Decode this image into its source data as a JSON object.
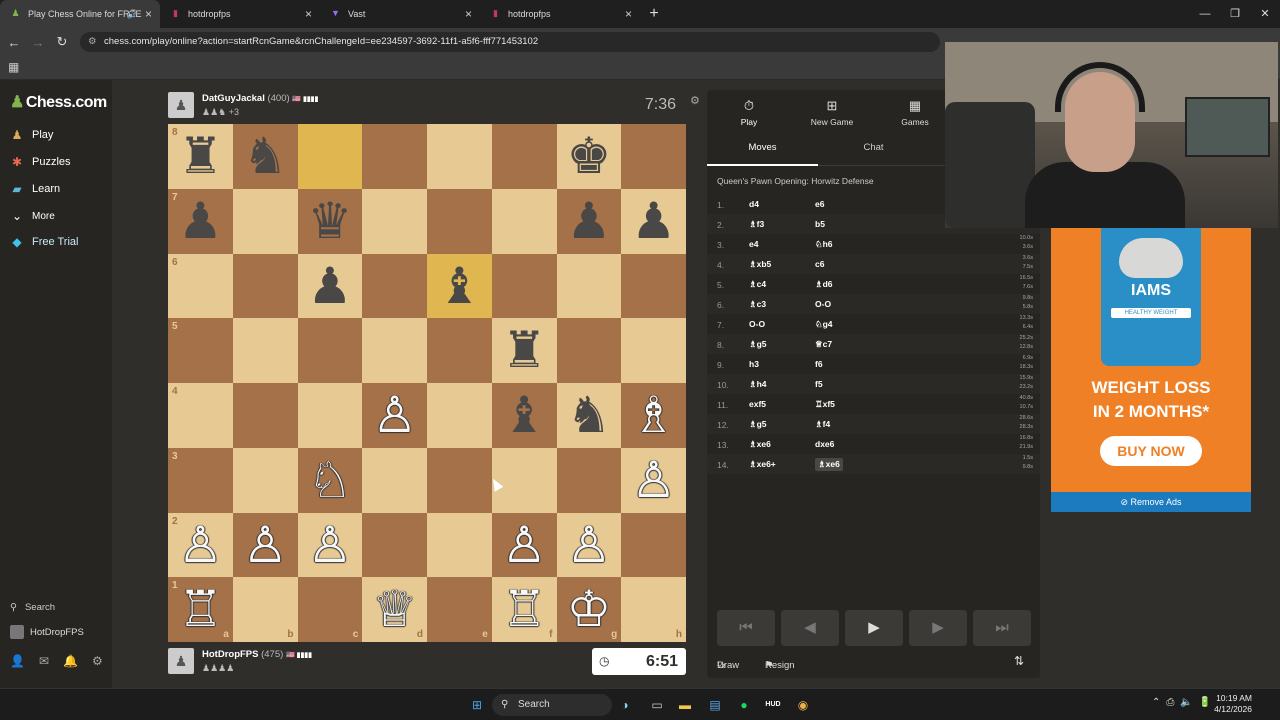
{
  "browser": {
    "tabs": [
      {
        "title": "Play Chess Online for FREE",
        "active": true
      },
      {
        "title": "hotdropfps",
        "active": false
      },
      {
        "title": "Vast",
        "active": false
      },
      {
        "title": "hotdropfps",
        "active": false
      }
    ],
    "url": "chess.com/play/online?action=startRcnGame&rcnChallengeId=ee234597-3692-11f1-a5f6-fff771453102"
  },
  "sidebar": {
    "logo": "Chess.com",
    "items": [
      {
        "label": "Play",
        "icon": "pawn-icon"
      },
      {
        "label": "Puzzles",
        "icon": "puzzle-icon"
      },
      {
        "label": "Learn",
        "icon": "learn-icon"
      },
      {
        "label": "More",
        "icon": "chevron-down-icon"
      },
      {
        "label": "Free Trial",
        "icon": "diamond-icon"
      }
    ],
    "search_label": "Search",
    "user": "HotDropFPS"
  },
  "top_player": {
    "name": "DatGuyJackal",
    "rating": "(400)",
    "captured": "♟♟♞ +3",
    "clock": "7:36"
  },
  "bottom_player": {
    "name": "HotDropFPS",
    "rating": "(475)",
    "captured": "♟♟♟♟",
    "clock": "6:51"
  },
  "board": {
    "files": [
      "a",
      "b",
      "c",
      "d",
      "e",
      "f",
      "g",
      "h"
    ],
    "ranks": [
      "8",
      "7",
      "6",
      "5",
      "4",
      "3",
      "2",
      "1"
    ],
    "highlights": [
      "c8",
      "e6"
    ],
    "pieces": [
      {
        "sq": "a8",
        "p": "♜",
        "c": "b"
      },
      {
        "sq": "b8",
        "p": "♞",
        "c": "b"
      },
      {
        "sq": "g8",
        "p": "♚",
        "c": "b"
      },
      {
        "sq": "a7",
        "p": "♟",
        "c": "b"
      },
      {
        "sq": "c7",
        "p": "♛",
        "c": "b"
      },
      {
        "sq": "g7",
        "p": "♟",
        "c": "b"
      },
      {
        "sq": "h7",
        "p": "♟",
        "c": "b"
      },
      {
        "sq": "c6",
        "p": "♟",
        "c": "b"
      },
      {
        "sq": "e6",
        "p": "♝",
        "c": "b"
      },
      {
        "sq": "f5",
        "p": "♜",
        "c": "b"
      },
      {
        "sq": "d4",
        "p": "♙",
        "c": "w"
      },
      {
        "sq": "f4",
        "p": "♝",
        "c": "b"
      },
      {
        "sq": "g4",
        "p": "♞",
        "c": "b"
      },
      {
        "sq": "h4",
        "p": "♗",
        "c": "w"
      },
      {
        "sq": "c3",
        "p": "♘",
        "c": "w"
      },
      {
        "sq": "h3",
        "p": "♙",
        "c": "w"
      },
      {
        "sq": "a2",
        "p": "♙",
        "c": "w"
      },
      {
        "sq": "b2",
        "p": "♙",
        "c": "w"
      },
      {
        "sq": "c2",
        "p": "♙",
        "c": "w"
      },
      {
        "sq": "f2",
        "p": "♙",
        "c": "w"
      },
      {
        "sq": "g2",
        "p": "♙",
        "c": "w"
      },
      {
        "sq": "a1",
        "p": "♖",
        "c": "w"
      },
      {
        "sq": "d1",
        "p": "♕",
        "c": "w"
      },
      {
        "sq": "f1",
        "p": "♖",
        "c": "w"
      },
      {
        "sq": "g1",
        "p": "♔",
        "c": "w"
      }
    ]
  },
  "panel": {
    "tabs": [
      {
        "label": "Play",
        "icon": "timer-icon"
      },
      {
        "label": "New Game",
        "icon": "plus-icon"
      },
      {
        "label": "Games",
        "icon": "grid-icon"
      }
    ],
    "subtabs": [
      "Moves",
      "Chat"
    ],
    "opening": "Queen's Pawn Opening: Horwitz Defense",
    "moves": [
      {
        "n": "1.",
        "w": "d4",
        "b": "e6",
        "tw": "",
        "tb": ""
      },
      {
        "n": "2.",
        "w": "♗f3",
        "b": "b5",
        "tw": "",
        "tb": ""
      },
      {
        "n": "3.",
        "w": "e4",
        "b": "♘h6",
        "tw": "10.0s",
        "tb": "3.6s"
      },
      {
        "n": "4.",
        "w": "♗xb5",
        "b": "c6",
        "tw": "3.6s",
        "tb": "7.5s"
      },
      {
        "n": "5.",
        "w": "♗c4",
        "b": "♗d6",
        "tw": "16.5s",
        "tb": "7.6s"
      },
      {
        "n": "6.",
        "w": "♗c3",
        "b": "O-O",
        "tw": "9.8s",
        "tb": "5.8s"
      },
      {
        "n": "7.",
        "w": "O-O",
        "b": "♘g4",
        "tw": "13.3s",
        "tb": "6.4s"
      },
      {
        "n": "8.",
        "w": "♗g5",
        "b": "♕c7",
        "tw": "25.2s",
        "tb": "12.8s"
      },
      {
        "n": "9.",
        "w": "h3",
        "b": "f6",
        "tw": "6.9s",
        "tb": "18.3s"
      },
      {
        "n": "10.",
        "w": "♗h4",
        "b": "f5",
        "tw": "15.9s",
        "tb": "23.2s"
      },
      {
        "n": "11.",
        "w": "exf5",
        "b": "♖xf5",
        "tw": "40.8s",
        "tb": "10.7s"
      },
      {
        "n": "12.",
        "w": "♗g5",
        "b": "♗f4",
        "tw": "28.6s",
        "tb": "28.3s"
      },
      {
        "n": "13.",
        "w": "♗xe6",
        "b": "dxe6",
        "tw": "16.8s",
        "tb": "21.9s"
      },
      {
        "n": "14.",
        "w": "♗xe6+",
        "b": "♗xe6",
        "tw": "1.5s",
        "tb": "9.8s"
      }
    ],
    "draw_label": "Draw",
    "resign_label": "Resign"
  },
  "ad": {
    "brand": "IAMS",
    "product": "HEALTHY WEIGHT",
    "headline_1": "WEIGHT LOSS",
    "headline_2": "IN 2 MONTHS*",
    "cta": "BUY NOW",
    "remove": "Remove Ads"
  },
  "taskbar": {
    "search": "Search",
    "time": "10:19 AM",
    "date": "4/12/2026"
  },
  "colors": {
    "light_square": "#e6c993",
    "dark_square": "#a57149",
    "highlight": "#e0b650",
    "accent_green": "#81b64c"
  }
}
